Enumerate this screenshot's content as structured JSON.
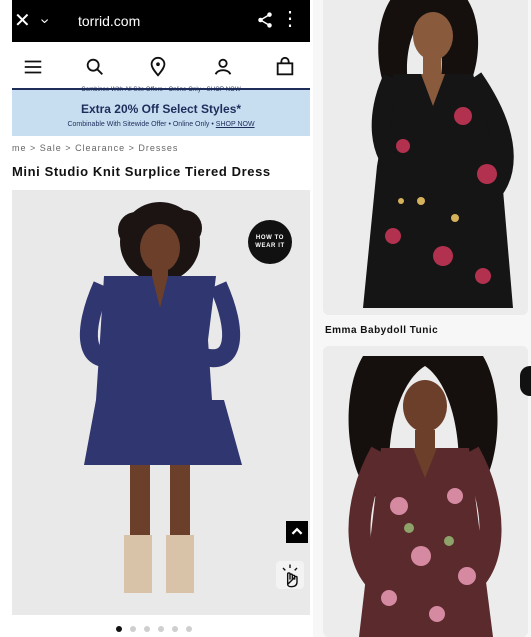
{
  "browser": {
    "url": "torrid.com",
    "close_glyph": "✕",
    "back_glyph": "›",
    "more_glyph": "⋮"
  },
  "nav": {
    "icons": [
      "menu-icon",
      "search-icon",
      "location-pin-icon",
      "account-icon",
      "shopping-bag-icon"
    ]
  },
  "promo": {
    "tiny": "Combines With All Site Offers • Online Only • SHOP NOW",
    "headline": "Extra 20% Off Select Styles*",
    "subtext": "Combinable With Sitewide Offer • Online Only •",
    "cta": "SHOP NOW"
  },
  "breadcrumbs": [
    "me",
    "Sale",
    "Clearance",
    "Dresses"
  ],
  "product": {
    "title": "Mini Studio Knit Surplice Tiered Dress",
    "how_to_badge": "HOW TO WEAR IT",
    "carousel_index": 0,
    "carousel_count": 6
  },
  "right_column": {
    "item_1_label": "Emma Babydoll Tunic"
  },
  "colors": {
    "nav_bar": "#000000",
    "promo_bg": "#c7def1",
    "promo_text": "#1f2d5a",
    "dress_navy": "#2f3670",
    "dress_black": "#151515",
    "dress_burgundy": "#5a2a2c"
  }
}
